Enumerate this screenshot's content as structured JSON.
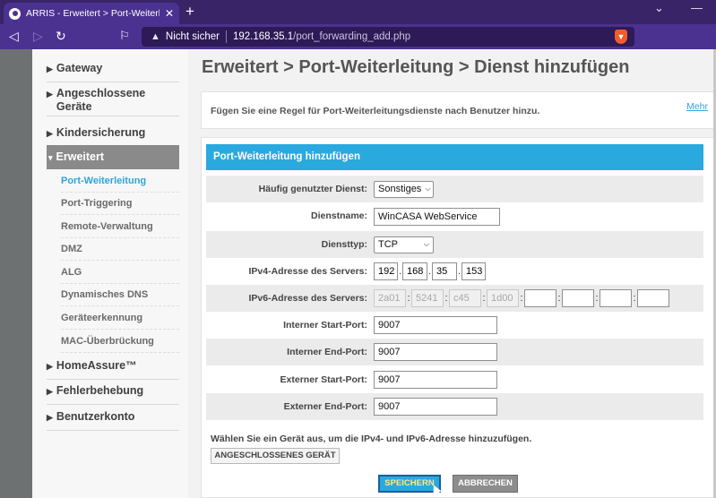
{
  "browser": {
    "tab_title": "ARRIS - Erweitert > Port-Weiterle",
    "tab_close": "✕",
    "new_tab": "+",
    "security_label": "Nicht sicher",
    "url_host": "192.168.35.1",
    "url_path": "/port_forwarding_add.php",
    "icons": [
      "back-icon",
      "forward-icon",
      "reload-icon",
      "bookmark-icon",
      "warning-icon",
      "brave-shield-icon",
      "chevron-down-icon"
    ]
  },
  "sidebar": {
    "categories": [
      {
        "label": "Gateway"
      },
      {
        "label": "Angeschlossene Geräte"
      },
      {
        "label": "Kindersicherung"
      },
      {
        "label": "Erweitert"
      },
      {
        "label": "HomeAssure™"
      },
      {
        "label": "Fehlerbehebung"
      },
      {
        "label": "Benutzerkonto"
      }
    ],
    "subitems": [
      {
        "label": "Port-Weiterleitung"
      },
      {
        "label": "Port-Triggering"
      },
      {
        "label": "Remote-Verwaltung"
      },
      {
        "label": "DMZ"
      },
      {
        "label": "ALG"
      },
      {
        "label": "Dynamisches DNS"
      },
      {
        "label": "Geräteerkennung"
      },
      {
        "label": "MAC-Überbrückung"
      }
    ]
  },
  "page": {
    "title": "Erweitert > Port-Weiterleitung > Dienst hinzufügen",
    "info": "Fügen Sie eine Regel für Port-Weiterleitungsdienste nach Benutzer hinzu.",
    "more_link": "Mehr"
  },
  "form": {
    "header": "Port-Weiterleitung hinzufügen",
    "common_service": {
      "label": "Häufig genutzter Dienst:",
      "value": "Sonstiges"
    },
    "service_name": {
      "label": "Dienstname:",
      "value": "WinCASA WebService"
    },
    "service_type": {
      "label": "Diensttyp:",
      "value": "TCP"
    },
    "ipv4": {
      "label": "IPv4-Adresse des Servers:",
      "octets": [
        "192",
        "168",
        "35",
        "153"
      ]
    },
    "ipv6": {
      "label": "IPv6-Adresse des Servers:",
      "placeholders": [
        "2a01",
        "5241",
        "c45",
        "1d00"
      ]
    },
    "internal_start": {
      "label": "Interner Start-Port:",
      "value": "9007"
    },
    "internal_end": {
      "label": "Interner End-Port:",
      "value": "9007"
    },
    "external_start": {
      "label": "Externer Start-Port:",
      "value": "9007"
    },
    "external_end": {
      "label": "Externer End-Port:",
      "value": "9007"
    },
    "device_hint": "Wählen Sie ein Gerät aus, um die IPv4- und IPv6-Adresse hinzuzufügen.",
    "device_button": "ANGESCHLOSSENES GERÄT",
    "save_button": "SPEICHERN",
    "cancel_button": "ABBRECHEN"
  },
  "colors": {
    "accent": "#2aa9df",
    "browser_chrome": "#4b3190",
    "sidebar_active": "#8a8a8a"
  }
}
